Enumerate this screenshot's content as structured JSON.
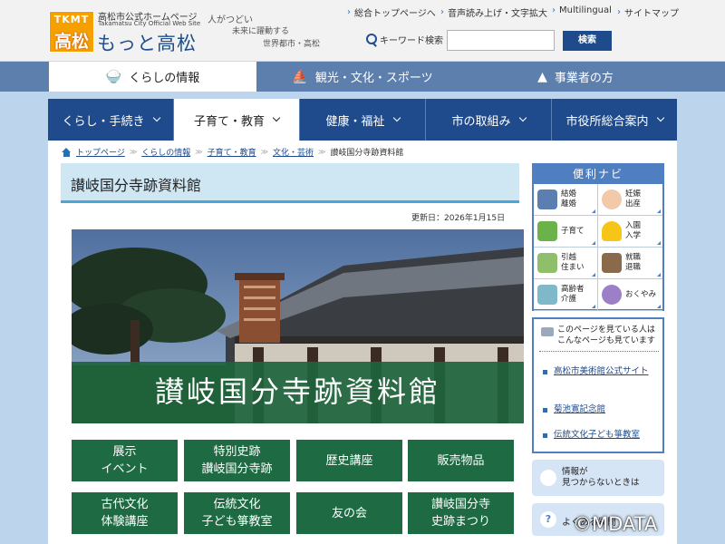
{
  "header": {
    "logo_top": "TKMT",
    "logo_main": "高松",
    "caption": "高松市公式ホームページ",
    "caption_en": "Takamatsu City Official Web Site",
    "site_name": "もっと高松",
    "slogan": [
      "人がつどい",
      "未来に躍動する",
      "世界都市・高松"
    ],
    "util_links": [
      "総合トップページへ",
      "音声読み上げ・文字拡大",
      "Multilingual",
      "サイトマップ"
    ],
    "search_label": "キーワード検索",
    "search_placeholder": "",
    "search_button": "検索"
  },
  "top_tabs": [
    "くらしの情報",
    "観光・文化・スポーツ",
    "事業者の方"
  ],
  "nav": [
    "くらし・手続き",
    "子育て・教育",
    "健康・福祉",
    "市の取組み",
    "市役所総合案内"
  ],
  "breadcrumb": [
    "トップページ",
    "くらしの情報",
    "子育て・教育",
    "文化・芸術",
    "讃岐国分寺跡資料館"
  ],
  "page": {
    "title": "讃岐国分寺跡資料館",
    "updated": "更新日：2026年1月15日",
    "hero_caption": "讃岐国分寺跡資料館"
  },
  "buttons": [
    "展示\nイベント",
    "特別史跡\n讃岐国分寺跡",
    "歴史講座",
    "販売物品",
    "古代文化\n体験講座",
    "伝統文化\n子ども箏教室",
    "友の会",
    "讃岐国分寺\n史跡まつり"
  ],
  "benri": {
    "title": "便利ナビ",
    "items": [
      "結婚\n離婚",
      "妊娠\n出産",
      "子育て",
      "入園\n入学",
      "引越\n住まい",
      "就職\n退職",
      "高齢者\n介護",
      "おくやみ"
    ]
  },
  "also": {
    "heading": "このページを見ている人は\nこんなページも見ています",
    "links": [
      "高松市美術館公式サイト",
      "菊池寛記念館",
      "伝統文化子ども箏教室"
    ]
  },
  "info_text": "情報が\n見つからないときは",
  "faq_text": "よくある質問",
  "copyright": "©MDATA",
  "colors": {
    "nav": "#1f4b8c",
    "button_green": "#1e6a43",
    "accent_blue": "#4f7fc0",
    "logo_orange": "#f6a000"
  }
}
